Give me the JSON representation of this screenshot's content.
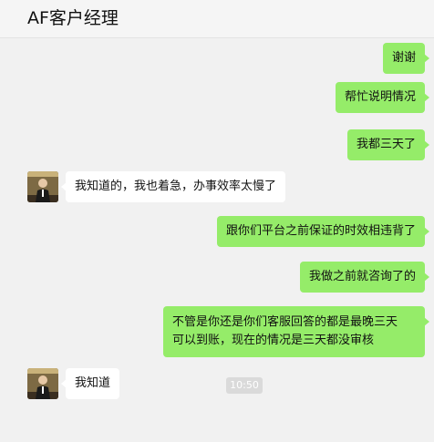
{
  "header": {
    "title": "AF客户经理"
  },
  "messages": [
    {
      "side": "right",
      "text": "谢谢"
    },
    {
      "side": "right",
      "text": "帮忙说明情况"
    },
    {
      "side": "right",
      "text": "我都三天了"
    },
    {
      "side": "left",
      "text": "我知道的，我也着急，办事效率太慢了"
    },
    {
      "side": "right",
      "text": "跟你们平台之前保证的时效相违背了"
    },
    {
      "side": "right",
      "text": "我做之前就咨询了的"
    },
    {
      "side": "right",
      "lines": [
        "不管是你还是你们客服回答的都是最晚三天",
        "可以到账，现在的情况是三天都没审核"
      ]
    },
    {
      "side": "left",
      "text": "我知道"
    }
  ],
  "timestamp": "10:50",
  "colors": {
    "right_bubble": "#95ec69",
    "left_bubble": "#ffffff",
    "background": "#f1f1f1"
  }
}
